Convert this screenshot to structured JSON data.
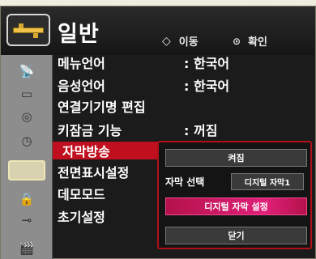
{
  "header": {
    "title": "일반",
    "move_label": "이동",
    "move_icon": "◆",
    "ok_label": "확인",
    "ok_icon": "⊙"
  },
  "categories": [
    {
      "name": "satellite-icon",
      "glyph": "📡",
      "selected": false
    },
    {
      "name": "picture-icon",
      "glyph": "▭",
      "selected": false
    },
    {
      "name": "speaker-icon",
      "glyph": "◎",
      "selected": false
    },
    {
      "name": "clock-icon",
      "glyph": "◷",
      "selected": false
    },
    {
      "name": "general-settings-icon",
      "glyph": "",
      "selected": true
    },
    {
      "name": "lock-icon",
      "glyph": "🔒",
      "selected": false
    },
    {
      "name": "input-plug-icon",
      "glyph": "⊸",
      "selected": false
    },
    {
      "name": "clapperboard-icon",
      "glyph": "🎬",
      "selected": false
    }
  ],
  "menu": {
    "items": [
      {
        "label": "메뉴언어",
        "value": ": 한국어"
      },
      {
        "label": "음성언어",
        "value": ": 한국어"
      },
      {
        "label": "연결기기명 편집",
        "value": ""
      },
      {
        "label": "키잠금 기능",
        "value": ": 꺼짐"
      },
      {
        "label": "자막방송",
        "value": ""
      },
      {
        "label": "전면표시설정",
        "value": ""
      },
      {
        "label": "데모모드",
        "value": ""
      },
      {
        "label": "초기설정",
        "value": ""
      }
    ],
    "active_index": 4
  },
  "popup": {
    "state_button": "켜짐",
    "subtitle_label": "자막 선택",
    "subtitle_value": "디지털 자막1",
    "digital_settings_button": "디지털 자막 설정",
    "close_button": "닫기"
  },
  "colors": {
    "accent": "#c01020",
    "highlight": "#e0207a",
    "panel": "#1b1b1b"
  }
}
